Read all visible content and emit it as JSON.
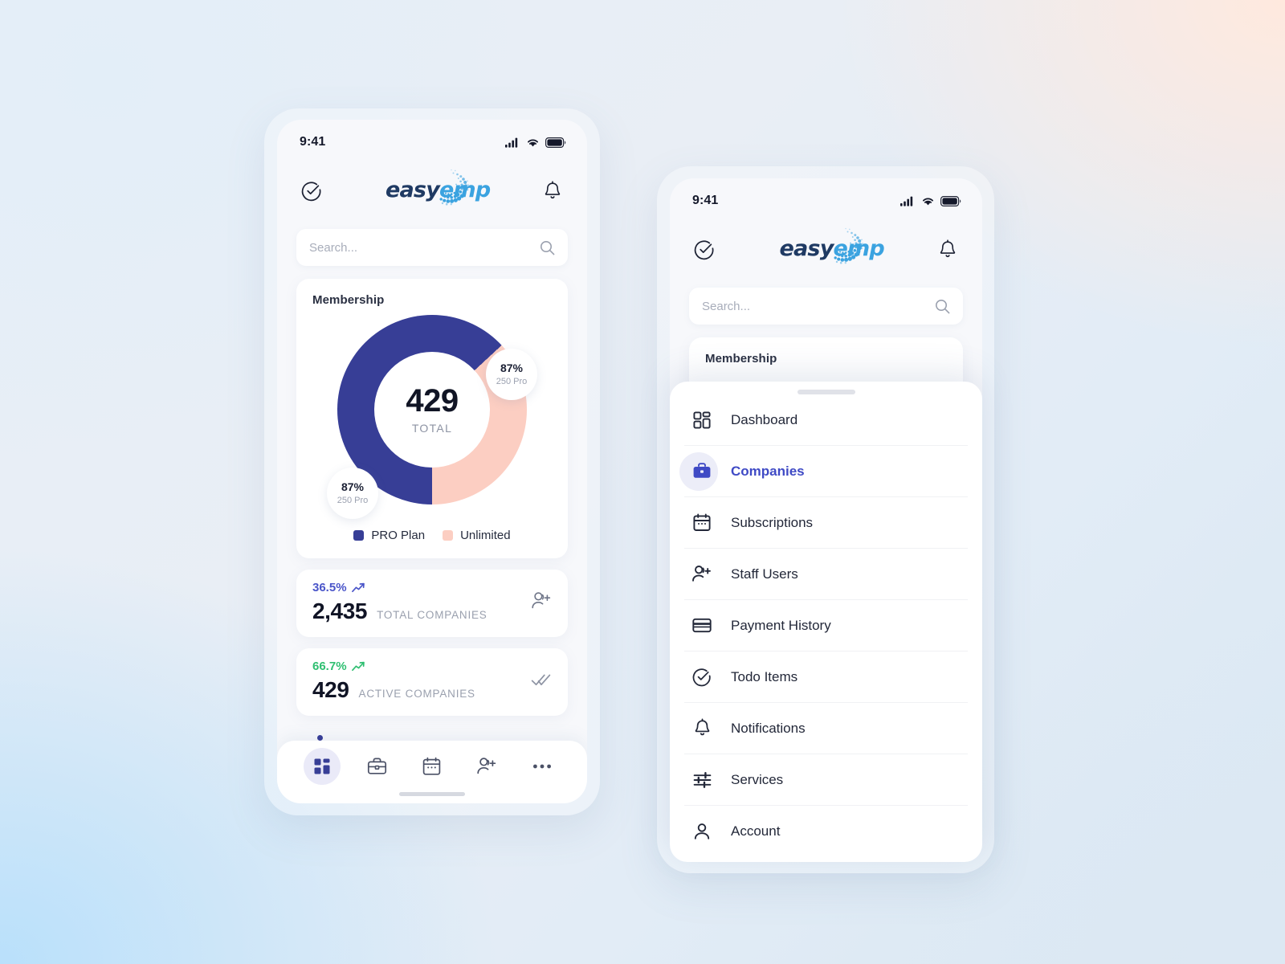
{
  "theme": {
    "pro_blue": "#373e96",
    "unlimited_pink": "#fccec2",
    "accent_indigo": "#3f4ac5",
    "green": "#2fbf71",
    "bg_peach": "#ffe9de",
    "bg_sky": "#b9e0fb",
    "bg_slate": "#dce8f3"
  },
  "phone_a": {
    "status": {
      "time": "9:41",
      "signal_icon": "cellular-signal-icon",
      "wifi_icon": "wifi-icon",
      "battery_icon": "battery-icon"
    },
    "header": {
      "check_icon": "check-circle-icon",
      "bell_icon": "bell-icon",
      "logo_primary": "easy",
      "logo_secondary": "emp"
    },
    "search": {
      "placeholder": "Search...",
      "value": "",
      "icon": "search-icon"
    },
    "membership": {
      "title": "Membership",
      "total_value": "429",
      "total_label": "TOTAL",
      "badge_pro": {
        "percent": "87%",
        "sub": "250 Pro"
      },
      "badge_unlimited": {
        "percent": "87%",
        "sub": "250 Pro"
      },
      "legend": [
        {
          "label": "PRO Plan",
          "color": "#373e96"
        },
        {
          "label": "Unlimited",
          "color": "#fccec2"
        }
      ]
    },
    "stats": [
      {
        "percent": "36.5%",
        "percent_color": "#4a55c9",
        "trend_icon": "trend-up-icon",
        "value": "2,435",
        "caption": "TOTAL COMPANIES",
        "side_icon": "add-person-icon"
      },
      {
        "percent": "66.7%",
        "percent_color": "#2fbf71",
        "trend_icon": "trend-up-icon",
        "value": "429",
        "caption": "ACTIVE COMPANIES",
        "side_icon": "double-check-icon"
      }
    ],
    "tabbar": [
      {
        "name": "dashboard",
        "icon": "dashboard-grid-icon",
        "active": true
      },
      {
        "name": "companies",
        "icon": "briefcase-icon",
        "active": false
      },
      {
        "name": "subscriptions",
        "icon": "calendar-icon",
        "active": false
      },
      {
        "name": "staff-users",
        "icon": "add-person-icon",
        "active": false
      },
      {
        "name": "more",
        "icon": "more-dots-icon",
        "active": false
      }
    ]
  },
  "phone_b": {
    "status": {
      "time": "9:41",
      "signal_icon": "cellular-signal-icon",
      "wifi_icon": "wifi-icon",
      "battery_icon": "battery-icon"
    },
    "header": {
      "check_icon": "check-circle-icon",
      "bell_icon": "bell-icon",
      "logo_primary": "easy",
      "logo_secondary": "emp"
    },
    "search": {
      "placeholder": "Search...",
      "value": "",
      "icon": "search-icon"
    },
    "membership": {
      "title": "Membership"
    },
    "menu": {
      "handle": "sheet-drag-handle",
      "items": [
        {
          "label": "Dashboard",
          "icon": "dashboard-grid-icon",
          "active": false
        },
        {
          "label": "Companies",
          "icon": "briefcase-icon",
          "active": true
        },
        {
          "label": "Subscriptions",
          "icon": "calendar-icon",
          "active": false
        },
        {
          "label": "Staff Users",
          "icon": "add-person-icon",
          "active": false
        },
        {
          "label": "Payment History",
          "icon": "credit-card-icon",
          "active": false
        },
        {
          "label": "Todo Items",
          "icon": "check-circle-icon",
          "active": false
        },
        {
          "label": "Notifications",
          "icon": "bell-icon",
          "active": false
        },
        {
          "label": "Services",
          "icon": "sliders-icon",
          "active": false
        },
        {
          "label": "Account",
          "icon": "person-icon",
          "active": false
        }
      ]
    }
  },
  "chart_data": {
    "type": "pie",
    "title": "Membership",
    "center_value": 429,
    "center_label": "TOTAL",
    "categories": [
      "PRO Plan",
      "Unlimited"
    ],
    "values": [
      67,
      33
    ],
    "colors": [
      "#373e96",
      "#fccec2"
    ],
    "annotations": [
      {
        "percent": "87%",
        "sub": "250 Pro",
        "position": "upper-right"
      },
      {
        "percent": "87%",
        "sub": "250 Pro",
        "position": "lower-left"
      }
    ],
    "legend": "bottom",
    "donut": true,
    "hole_ratio": 0.61
  }
}
